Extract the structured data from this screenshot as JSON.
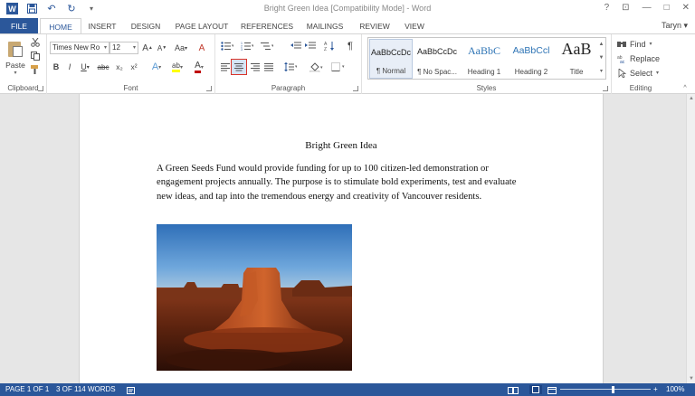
{
  "window": {
    "title": "Bright Green Idea [Compatibility Mode] - Word",
    "user": "Taryn",
    "controls": {
      "help": "?",
      "ribbon_display": "⊡",
      "minimize": "—",
      "maximize": "□",
      "close": "✕"
    }
  },
  "qat": {
    "save_icon": "💾",
    "undo_icon": "↶",
    "redo_icon": "↻",
    "more_icon": "▾"
  },
  "tabs": [
    "FILE",
    "HOME",
    "INSERT",
    "DESIGN",
    "PAGE LAYOUT",
    "REFERENCES",
    "MAILINGS",
    "REVIEW",
    "VIEW"
  ],
  "ribbon": {
    "clipboard": {
      "label": "Clipboard",
      "paste": "Paste"
    },
    "font": {
      "label": "Font",
      "font_name": "Times New Ro",
      "font_size": "12",
      "grow": "A",
      "shrink": "A",
      "case": "Aa",
      "clear": "A",
      "bold": "B",
      "italic": "I",
      "underline": "U",
      "strike": "abc",
      "subscript": "x₂",
      "superscript": "x²",
      "effects": "A",
      "highlight": "ab",
      "font_color": "A",
      "accent_red": "#c00000",
      "accent_yellow": "#ffff00"
    },
    "paragraph": {
      "label": "Paragraph",
      "show_marks": "¶"
    },
    "styles": {
      "label": "Styles",
      "items": [
        {
          "preview": "AaBbCcDc",
          "name": "¶ Normal"
        },
        {
          "preview": "AaBbCcDc",
          "name": "¶ No Spac..."
        },
        {
          "preview": "AaBbC",
          "name": "Heading 1"
        },
        {
          "preview": "AaBbCcl",
          "name": "Heading 2"
        },
        {
          "preview": "AaB",
          "name": "Title"
        }
      ]
    },
    "editing": {
      "label": "Editing",
      "find": "Find",
      "replace": "Replace",
      "select": "Select"
    }
  },
  "document": {
    "title": "Bright Green Idea",
    "paragraph": "A Green Seeds Fund would provide funding for up to 100 citizen-led demonstration or engagement projects annually. The purpose is to stimulate bold experiments, test and evaluate new ideas, and tap into the tremendous energy and creativity of Vancouver residents."
  },
  "statusbar": {
    "page": "PAGE 1 OF 1",
    "words": "3 OF 114 WORDS",
    "zoom_out": "−",
    "zoom_in": "+",
    "zoom": "100%",
    "zoom_percent": 100
  }
}
